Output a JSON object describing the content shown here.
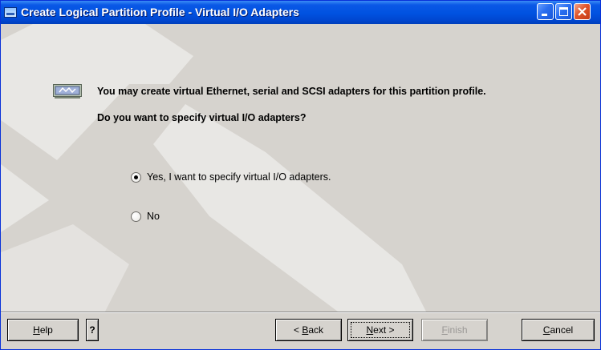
{
  "window": {
    "title": "Create Logical Partition Profile - Virtual I/O Adapters",
    "controls": {
      "minimize": "minimize-icon",
      "maximize": "maximize-icon",
      "close": "close-icon"
    }
  },
  "content": {
    "intro": "You may create virtual Ethernet, serial and SCSI adapters for this partition profile.",
    "question": "Do you want to specify virtual I/O adapters?",
    "options": [
      {
        "label": "Yes, I want to specify virtual I/O adapters.",
        "selected": true
      },
      {
        "label": "No",
        "selected": false
      }
    ]
  },
  "buttons": {
    "help": {
      "mnemonic": "H",
      "rest": "elp"
    },
    "question": "?",
    "back": {
      "prefix": "< ",
      "mnemonic": "B",
      "rest": "ack"
    },
    "next": {
      "mnemonic": "N",
      "rest": "ext >"
    },
    "finish": {
      "mnemonic": "F",
      "rest": "inish",
      "enabled": false
    },
    "cancel": {
      "mnemonic": "C",
      "rest": "ancel"
    }
  },
  "colors": {
    "titlebar": "#0052e0",
    "dialog_bg": "#d6d3ce",
    "close_button": "#e0552b",
    "disabled_text": "#9a9896"
  }
}
